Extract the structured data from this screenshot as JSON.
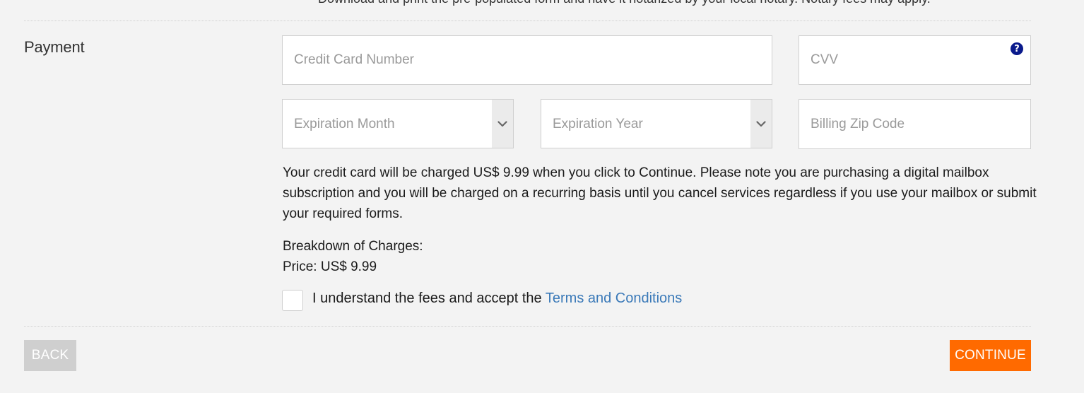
{
  "top_note": "Download and print the pre-populated form and have it notarized by your local notary. Notary fees may apply.",
  "payment": {
    "label": "Payment",
    "card_number_placeholder": "Credit Card Number",
    "cvv_placeholder": "CVV",
    "cvv_help_icon": "question-circle-icon",
    "exp_month_placeholder": "Expiration Month",
    "exp_year_placeholder": "Expiration Year",
    "zip_placeholder": "Billing Zip Code"
  },
  "notice": "Your credit card will be charged US$ 9.99 when you click to Continue. Please note you are purchasing a digital mailbox subscription and you will be charged on a recurring basis until you cancel services regardless if you use your mailbox or submit your required forms.",
  "breakdown": {
    "heading": "Breakdown of Charges:",
    "price": "Price: US$ 9.99"
  },
  "terms": {
    "text": "I understand the fees and accept the ",
    "link": "Terms and Conditions"
  },
  "buttons": {
    "back": "BACK",
    "continue": "CONTINUE"
  },
  "colors": {
    "background": "#f3f3f3",
    "continue": "#ff6a00",
    "back": "#cfcfcf",
    "link": "#3a79b8",
    "help_icon": "#0a1a8c"
  }
}
